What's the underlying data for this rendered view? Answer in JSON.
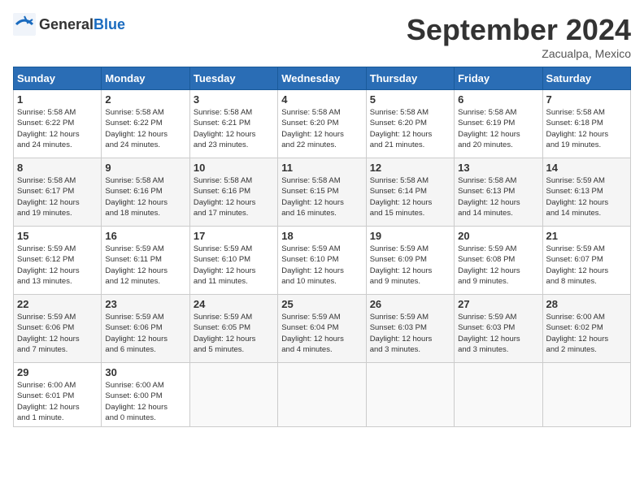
{
  "logo": {
    "general": "General",
    "blue": "Blue"
  },
  "title": "September 2024",
  "location": "Zacualpa, Mexico",
  "weekdays": [
    "Sunday",
    "Monday",
    "Tuesday",
    "Wednesday",
    "Thursday",
    "Friday",
    "Saturday"
  ],
  "weeks": [
    [
      {
        "day": "1",
        "lines": [
          "Sunrise: 5:58 AM",
          "Sunset: 6:22 PM",
          "Daylight: 12 hours",
          "and 24 minutes."
        ]
      },
      {
        "day": "2",
        "lines": [
          "Sunrise: 5:58 AM",
          "Sunset: 6:22 PM",
          "Daylight: 12 hours",
          "and 24 minutes."
        ]
      },
      {
        "day": "3",
        "lines": [
          "Sunrise: 5:58 AM",
          "Sunset: 6:21 PM",
          "Daylight: 12 hours",
          "and 23 minutes."
        ]
      },
      {
        "day": "4",
        "lines": [
          "Sunrise: 5:58 AM",
          "Sunset: 6:20 PM",
          "Daylight: 12 hours",
          "and 22 minutes."
        ]
      },
      {
        "day": "5",
        "lines": [
          "Sunrise: 5:58 AM",
          "Sunset: 6:20 PM",
          "Daylight: 12 hours",
          "and 21 minutes."
        ]
      },
      {
        "day": "6",
        "lines": [
          "Sunrise: 5:58 AM",
          "Sunset: 6:19 PM",
          "Daylight: 12 hours",
          "and 20 minutes."
        ]
      },
      {
        "day": "7",
        "lines": [
          "Sunrise: 5:58 AM",
          "Sunset: 6:18 PM",
          "Daylight: 12 hours",
          "and 19 minutes."
        ]
      }
    ],
    [
      {
        "day": "8",
        "lines": [
          "Sunrise: 5:58 AM",
          "Sunset: 6:17 PM",
          "Daylight: 12 hours",
          "and 19 minutes."
        ]
      },
      {
        "day": "9",
        "lines": [
          "Sunrise: 5:58 AM",
          "Sunset: 6:16 PM",
          "Daylight: 12 hours",
          "and 18 minutes."
        ]
      },
      {
        "day": "10",
        "lines": [
          "Sunrise: 5:58 AM",
          "Sunset: 6:16 PM",
          "Daylight: 12 hours",
          "and 17 minutes."
        ]
      },
      {
        "day": "11",
        "lines": [
          "Sunrise: 5:58 AM",
          "Sunset: 6:15 PM",
          "Daylight: 12 hours",
          "and 16 minutes."
        ]
      },
      {
        "day": "12",
        "lines": [
          "Sunrise: 5:58 AM",
          "Sunset: 6:14 PM",
          "Daylight: 12 hours",
          "and 15 minutes."
        ]
      },
      {
        "day": "13",
        "lines": [
          "Sunrise: 5:58 AM",
          "Sunset: 6:13 PM",
          "Daylight: 12 hours",
          "and 14 minutes."
        ]
      },
      {
        "day": "14",
        "lines": [
          "Sunrise: 5:59 AM",
          "Sunset: 6:13 PM",
          "Daylight: 12 hours",
          "and 14 minutes."
        ]
      }
    ],
    [
      {
        "day": "15",
        "lines": [
          "Sunrise: 5:59 AM",
          "Sunset: 6:12 PM",
          "Daylight: 12 hours",
          "and 13 minutes."
        ]
      },
      {
        "day": "16",
        "lines": [
          "Sunrise: 5:59 AM",
          "Sunset: 6:11 PM",
          "Daylight: 12 hours",
          "and 12 minutes."
        ]
      },
      {
        "day": "17",
        "lines": [
          "Sunrise: 5:59 AM",
          "Sunset: 6:10 PM",
          "Daylight: 12 hours",
          "and 11 minutes."
        ]
      },
      {
        "day": "18",
        "lines": [
          "Sunrise: 5:59 AM",
          "Sunset: 6:10 PM",
          "Daylight: 12 hours",
          "and 10 minutes."
        ]
      },
      {
        "day": "19",
        "lines": [
          "Sunrise: 5:59 AM",
          "Sunset: 6:09 PM",
          "Daylight: 12 hours",
          "and 9 minutes."
        ]
      },
      {
        "day": "20",
        "lines": [
          "Sunrise: 5:59 AM",
          "Sunset: 6:08 PM",
          "Daylight: 12 hours",
          "and 9 minutes."
        ]
      },
      {
        "day": "21",
        "lines": [
          "Sunrise: 5:59 AM",
          "Sunset: 6:07 PM",
          "Daylight: 12 hours",
          "and 8 minutes."
        ]
      }
    ],
    [
      {
        "day": "22",
        "lines": [
          "Sunrise: 5:59 AM",
          "Sunset: 6:06 PM",
          "Daylight: 12 hours",
          "and 7 minutes."
        ]
      },
      {
        "day": "23",
        "lines": [
          "Sunrise: 5:59 AM",
          "Sunset: 6:06 PM",
          "Daylight: 12 hours",
          "and 6 minutes."
        ]
      },
      {
        "day": "24",
        "lines": [
          "Sunrise: 5:59 AM",
          "Sunset: 6:05 PM",
          "Daylight: 12 hours",
          "and 5 minutes."
        ]
      },
      {
        "day": "25",
        "lines": [
          "Sunrise: 5:59 AM",
          "Sunset: 6:04 PM",
          "Daylight: 12 hours",
          "and 4 minutes."
        ]
      },
      {
        "day": "26",
        "lines": [
          "Sunrise: 5:59 AM",
          "Sunset: 6:03 PM",
          "Daylight: 12 hours",
          "and 3 minutes."
        ]
      },
      {
        "day": "27",
        "lines": [
          "Sunrise: 5:59 AM",
          "Sunset: 6:03 PM",
          "Daylight: 12 hours",
          "and 3 minutes."
        ]
      },
      {
        "day": "28",
        "lines": [
          "Sunrise: 6:00 AM",
          "Sunset: 6:02 PM",
          "Daylight: 12 hours",
          "and 2 minutes."
        ]
      }
    ],
    [
      {
        "day": "29",
        "lines": [
          "Sunrise: 6:00 AM",
          "Sunset: 6:01 PM",
          "Daylight: 12 hours",
          "and 1 minute."
        ]
      },
      {
        "day": "30",
        "lines": [
          "Sunrise: 6:00 AM",
          "Sunset: 6:00 PM",
          "Daylight: 12 hours",
          "and 0 minutes."
        ]
      },
      null,
      null,
      null,
      null,
      null
    ]
  ]
}
